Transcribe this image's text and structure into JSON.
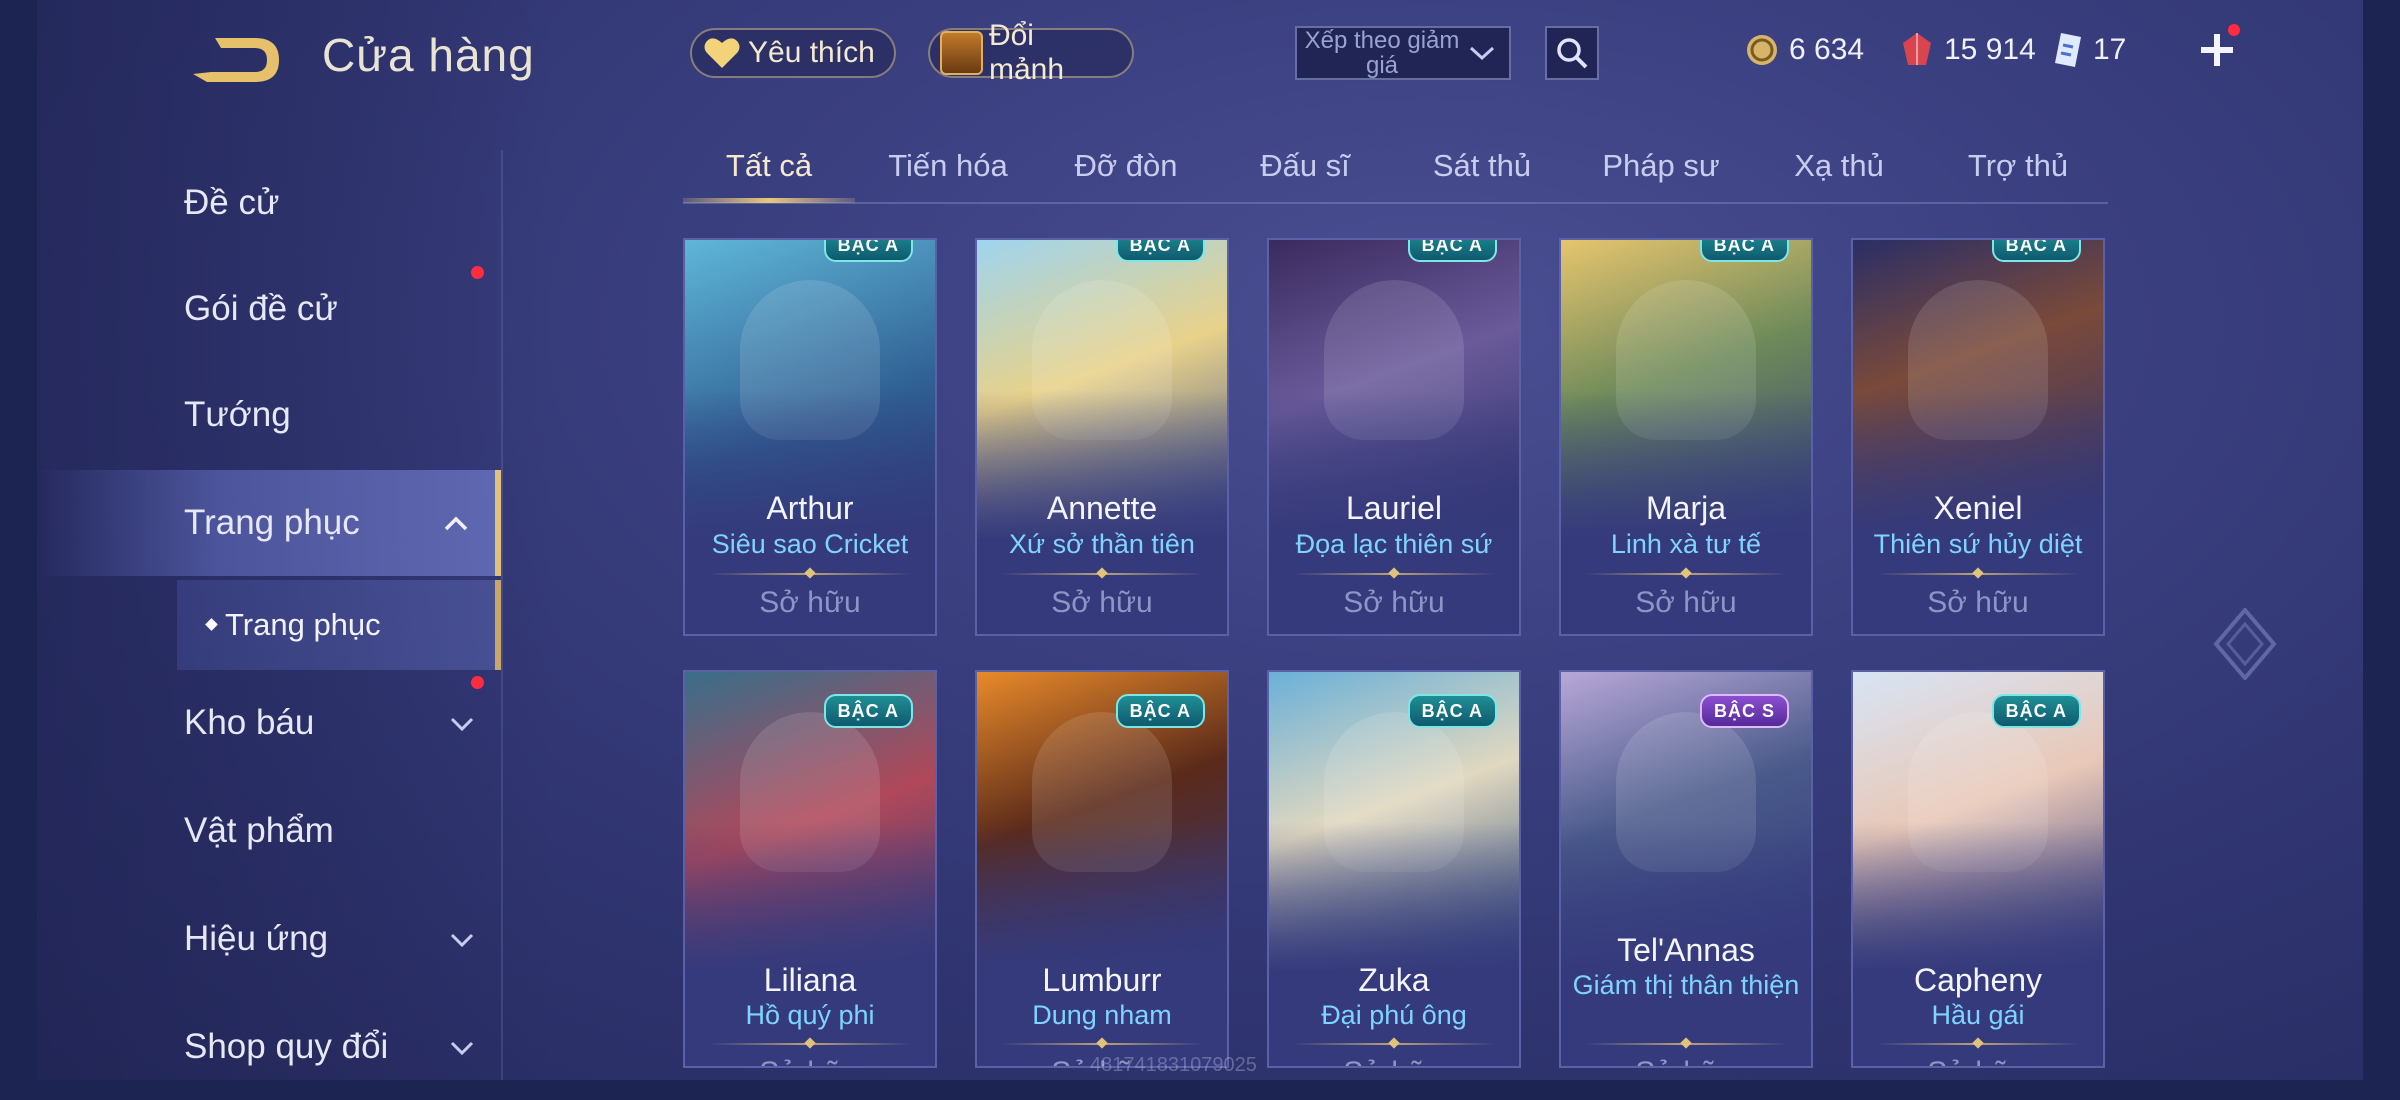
{
  "header": {
    "title": "Cửa hàng",
    "favorites_label": "Yêu thích",
    "fragments_label": "Đổi mảnh",
    "sort_label": "Xếp theo giảm giá",
    "currencies": [
      {
        "icon": "gold-coin-icon",
        "value": "6 634"
      },
      {
        "icon": "ruby-icon",
        "value": "15 914"
      },
      {
        "icon": "voucher-icon",
        "value": "17"
      }
    ]
  },
  "sidebar": {
    "items": [
      {
        "label": "Đề cử"
      },
      {
        "label": "Gói đề cử"
      },
      {
        "label": "Tướng"
      },
      {
        "label": "Trang phục"
      },
      {
        "label": "Kho báu"
      },
      {
        "label": "Vật phẩm"
      },
      {
        "label": "Hiệu ứng"
      },
      {
        "label": "Shop quy đổi"
      }
    ],
    "sub_item": "Trang phục"
  },
  "tabs": [
    "Tất cả",
    "Tiến hóa",
    "Đỡ đòn",
    "Đấu sĩ",
    "Sát thủ",
    "Pháp sư",
    "Xạ thủ",
    "Trợ thủ"
  ],
  "cards": [
    {
      "hero": "Arthur",
      "skin": "Siêu sao Cricket",
      "tier": "BẬC A",
      "status": "Sở hữu"
    },
    {
      "hero": "Annette",
      "skin": "Xứ sở thần tiên",
      "tier": "BẬC A",
      "status": "Sở hữu"
    },
    {
      "hero": "Lauriel",
      "skin": "Đọa lạc thiên sứ",
      "tier": "BẬC A",
      "status": "Sở hữu"
    },
    {
      "hero": "Marja",
      "skin": "Linh xà tư tế",
      "tier": "BẬC A",
      "status": "Sở hữu"
    },
    {
      "hero": "Xeniel",
      "skin": "Thiên sứ hủy diệt",
      "tier": "BẬC A",
      "status": "Sở hữu"
    },
    {
      "hero": "Liliana",
      "skin": "Hồ quý phi",
      "tier": "BẬC A",
      "status": "Sở hữu"
    },
    {
      "hero": "Lumburr",
      "skin": "Dung nham",
      "tier": "BẬC A",
      "status": "Sở hữu"
    },
    {
      "hero": "Zuka",
      "skin": "Đại phú ông",
      "tier": "BẬC A",
      "status": "Sở hữu"
    },
    {
      "hero": "Tel'Annas",
      "skin": "Giám thị thân thiện",
      "tier": "BẬC S",
      "status": "Sở hữu"
    },
    {
      "hero": "Capheny",
      "skin": "Hầu gái",
      "tier": "BẬC A",
      "status": "Sở hữu"
    }
  ],
  "watermark": "4817418​31079025",
  "colors": {
    "accent_gold": "#e0c27a",
    "skin_name": "#7fd4ff",
    "tier_a": "#1f8f95",
    "tier_s": "#8b4fd1",
    "notification": "#ff2c40"
  }
}
